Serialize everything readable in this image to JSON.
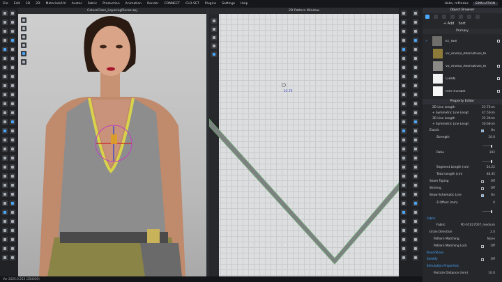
{
  "menu": [
    "File",
    "Edit",
    "3D",
    "2D",
    "Materials/UV",
    "Avatar",
    "Fabric",
    "Production",
    "Animation",
    "Render",
    "CONNECT",
    "CLO-SET",
    "Plugins",
    "Settings",
    "Help"
  ],
  "user": {
    "greeting": "Hello, mflindes",
    "mode": "SIMULATION"
  },
  "view3d": {
    "title": "ColossClass_LayeringPieces.zpj"
  },
  "view2d": {
    "title": "2D Pattern Window",
    "measure_label": "23.75"
  },
  "object_browser": {
    "title": "Object Browser",
    "add_label": "+ Add",
    "sort_label": "Sort",
    "primary_label": "Primary",
    "fabrics": [
      {
        "name": "V2_Twill",
        "color": "#6f6e6a"
      },
      {
        "name": "V2_Animal_Alternatives_te",
        "color": "#8e7b3a"
      },
      {
        "name": "V2_Animal_Alternatives_te",
        "color": "#8c8a86"
      },
      {
        "name": "CHAIN",
        "color": "#f2f2f2"
      },
      {
        "name": "trim invisible",
        "color": "#f7f7f7"
      }
    ]
  },
  "property_editor": {
    "title": "Property Editor",
    "rows": [
      {
        "label": "2D Line Length",
        "value": "23.75cm"
      },
      {
        "label": "+ Symmetric Line Lengt",
        "value": "47.50cm"
      },
      {
        "label": "3D Line Length",
        "value": "25.39cm"
      },
      {
        "label": "+ Symmetric Line Lengt",
        "value": "50.68cm"
      },
      {
        "label": "Elastic",
        "value": "On"
      },
      {
        "label": "Strength",
        "value": "10.0"
      },
      {
        "label": "Ratio",
        "value": "102"
      },
      {
        "label": "Segment Length (cm)",
        "value": "24.22"
      },
      {
        "label": "Total Length (cm)",
        "value": "48.45"
      },
      {
        "label": "Seam Taping",
        "value": "Off"
      },
      {
        "label": "Shirring",
        "value": "Off"
      },
      {
        "label": "Show Schematic Line",
        "value": "On"
      },
      {
        "label": "Z-Offset (mm)",
        "value": "0"
      },
      {
        "label": "Fabric",
        "value": ""
      },
      {
        "label": "Fabric",
        "value": "PD-0C027007_medium"
      },
      {
        "label": "Grain Direction",
        "value": "2.4"
      },
      {
        "label": "Pattern Matching",
        "value": "None"
      },
      {
        "label": "Pattern Matching Lock",
        "value": "Off"
      },
      {
        "label": "Bond/Skive",
        "value": ""
      },
      {
        "label": "Solidify",
        "value": "Off"
      },
      {
        "label": "Simulation Properties",
        "value": ""
      },
      {
        "label": "Particle Distance (mm)",
        "value": "10.0"
      }
    ]
  },
  "status": "Ver 2025.0.253 (254030)"
}
